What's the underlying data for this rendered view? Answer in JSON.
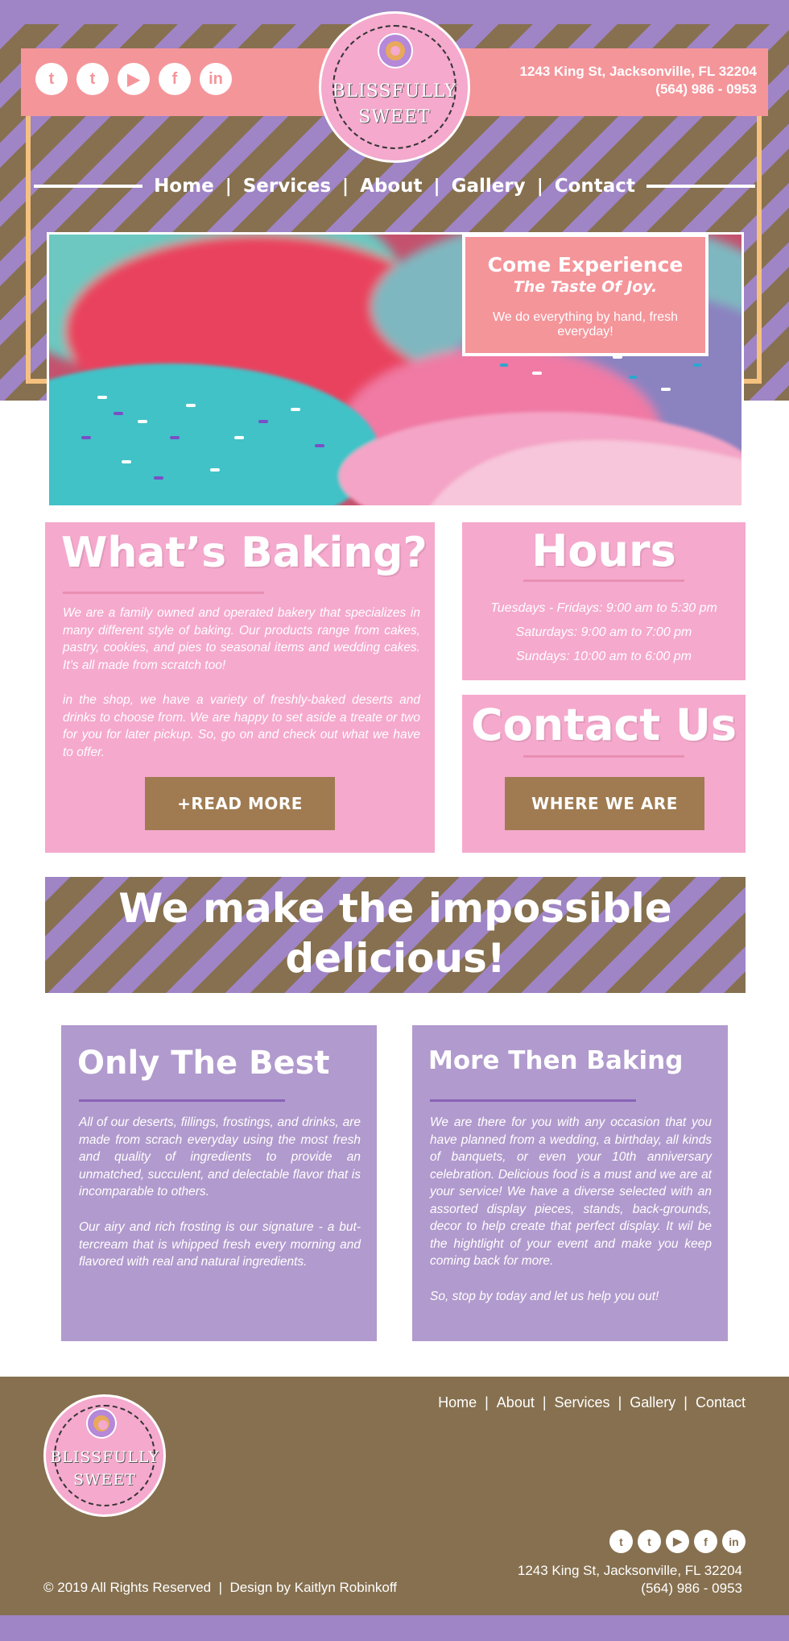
{
  "header": {
    "social": [
      "t",
      "t",
      "▶",
      "f",
      "in"
    ],
    "address_line1": "1243 King St, Jacksonville, FL 32204",
    "phone": "(564) 986 - 0953",
    "logo_line1": "BLISSFULLY",
    "logo_line2": "SWEET"
  },
  "nav": {
    "items": [
      "Home",
      "Services",
      "About",
      "Gallery",
      "Contact"
    ],
    "separator": "|"
  },
  "hero": {
    "title": "Come Experience",
    "subtitle": "The Taste Of Joy.",
    "tagline": "We do everything by hand, fresh everyday!"
  },
  "baking": {
    "title": "What’s Baking?",
    "p1": "We are a family owned and operated bakery that specializes in many different style of baking. Our products range from cakes, pastry, cookies, and pies to seasonal items and wedding cakes. It’s all made from scratch too!",
    "p2": "in the shop, we have a variety of freshly-baked deserts and drinks to choose from. We are happy to set aside a treate or two for you for later pickup. So, go on and check out what we have to offer.",
    "button": "+READ MORE"
  },
  "hours": {
    "title": "Hours",
    "lines": [
      "Tuesdays - Fridays: 9:00 am to 5:30 pm",
      "Saturdays: 9:00 am to 7:00 pm",
      "Sundays: 10:00 am to 6:00 pm"
    ]
  },
  "contact": {
    "title": "Contact Us",
    "button": "WHERE WE ARE"
  },
  "banner": {
    "line1": "We make the impossible",
    "line2": "delicious!"
  },
  "best": {
    "title": "Only The Best",
    "p1": "All of our deserts, fillings, frostings, and drinks, are made from scrach everyday using the most fresh and quality of ingredients to provide an unmatched, succulent, and delectable flavor that is incomparable to others.",
    "p2": "Our airy and rich frosting is our signature - a but-tercream that is whipped fresh every morning and flavored with real and natural ingredients."
  },
  "more": {
    "title": "More Then Baking",
    "p1": "We are there for you with any occasion that you have planned  from a wedding, a birthday, all kinds of banquets, or even your 10th anniversary celebration. Delicious food is a must and we are at your service!  We have a diverse selected with an assorted display pieces, stands, back-grounds, decor to help create that perfect display.  It wil be the hightlight of your event and make you keep coming back for more.",
    "p2": "So, stop by today and let us help you out!"
  },
  "footer": {
    "nav": [
      "Home",
      "About",
      "Services",
      "Gallery",
      "Contact"
    ],
    "separator": "|",
    "social": [
      "t",
      "t",
      "▶",
      "f",
      "in"
    ],
    "address_line1": "1243 King St, Jacksonville, FL 32204",
    "phone": "(564) 986 - 0953",
    "copyright": "© 2019 All Rights Reserved  |  Design by Kaitlyn Robinkoff"
  },
  "colors": {
    "purple": "#9f84c6",
    "brown": "#86704f",
    "pink": "#f5a9cd",
    "salmon": "#f4959a",
    "button_brown": "#a07b51",
    "lavender": "#b19acd"
  }
}
